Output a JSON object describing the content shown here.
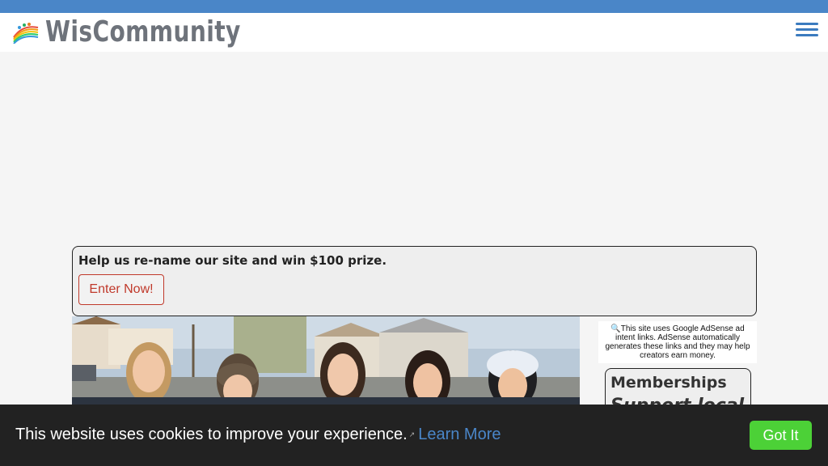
{
  "header": {
    "site_name": "WisCommunity",
    "logo_icon": "rainbow-logo-icon",
    "menu_icon": "hamburger-menu-icon"
  },
  "promo": {
    "headline": "Help us re-name our site and win $100 prize.",
    "button_label": "Enter Now!"
  },
  "adsense_notice": {
    "icon": "magnifier-icon",
    "text": "This site uses Google AdSense ad intent links. AdSense automatically generates these links and they may help creators earn money."
  },
  "memberships": {
    "title": "Memberships",
    "subtitle": "Support local"
  },
  "cookie_bar": {
    "message": "This website uses cookies to improve your experience.",
    "learn_more": "Learn More",
    "button_label": "Got It"
  },
  "colors": {
    "top_stripe": "#4a86c8",
    "logo_text": "#6e737b",
    "enter_button": "#c0392b",
    "link": "#4a86c8",
    "got_it": "#4cd137",
    "cookie_bg": "#222222"
  }
}
